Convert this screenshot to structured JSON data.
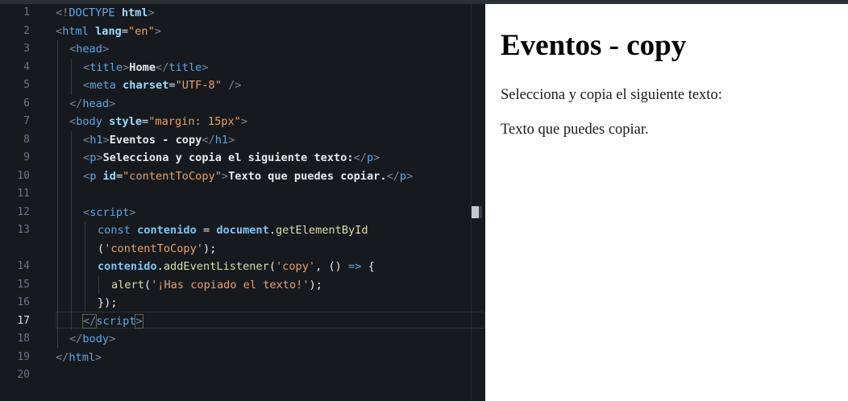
{
  "editor": {
    "line_numbers": [
      "1",
      "2",
      "3",
      "4",
      "5",
      "6",
      "7",
      "8",
      "9",
      "10",
      "11",
      "12",
      "13",
      "",
      "14",
      "15",
      "16",
      "17",
      "18",
      "19",
      "20"
    ],
    "active_line": "17",
    "code": {
      "l1": {
        "a": "<!",
        "b": "DOCTYPE",
        "c": " html",
        "d": ">"
      },
      "l2": {
        "a": "<",
        "b": "html",
        "c": " lang",
        "d": "=",
        "e": "\"en\"",
        "f": ">"
      },
      "l3": {
        "a": "<",
        "b": "head",
        "c": ">"
      },
      "l4": {
        "a": "<",
        "b": "title",
        "c": ">",
        "d": "Home",
        "e": "</",
        "f": "title",
        "g": ">"
      },
      "l5": {
        "a": "<",
        "b": "meta",
        "c": " charset",
        "d": "=",
        "e": "\"UTF-8\"",
        "f": " />"
      },
      "l6": {
        "a": "</",
        "b": "head",
        "c": ">"
      },
      "l7": {
        "a": "<",
        "b": "body",
        "c": " style",
        "d": "=",
        "e": "\"margin: 15px\"",
        "f": ">"
      },
      "l8": {
        "a": "<",
        "b": "h1",
        "c": ">",
        "d": "Eventos - copy",
        "e": "</",
        "f": "h1",
        "g": ">"
      },
      "l9": {
        "a": "<",
        "b": "p",
        "c": ">",
        "d": "Selecciona y copia el siguiente texto:",
        "e": "</",
        "f": "p",
        "g": ">"
      },
      "l10": {
        "a": "<",
        "b": "p",
        "c": " id",
        "d": "=",
        "e": "\"contentToCopy\"",
        "f": ">",
        "g": "Texto que puedes copiar.",
        "h": "</",
        "i": "p",
        "j": ">"
      },
      "l12": {
        "a": "<",
        "b": "script",
        "c": ">"
      },
      "l13": {
        "a": "const",
        "b": " contenido",
        "c": " = ",
        "d": "document",
        "e": ".",
        "f": "getElementById"
      },
      "l13b": {
        "a": "(",
        "b": "'contentToCopy'",
        "c": ");"
      },
      "l14": {
        "a": "contenido",
        "b": ".",
        "c": "addEventListener",
        "d": "(",
        "e": "'copy'",
        "f": ", () ",
        "g": "=>",
        "h": " {"
      },
      "l15": {
        "a": "alert",
        "b": "(",
        "c": "'¡Has copiado el texto!'",
        "d": ");"
      },
      "l16": {
        "a": "});"
      },
      "l17": {
        "a": "</",
        "b": "script",
        "c": ">"
      },
      "l18": {
        "a": "</",
        "b": "body",
        "c": ">"
      },
      "l19": {
        "a": "</",
        "b": "html",
        "c": ">"
      }
    }
  },
  "preview": {
    "heading": "Eventos - copy",
    "para1": "Selecciona y copia el siguiente texto:",
    "para2": "Texto que puedes copiar."
  }
}
